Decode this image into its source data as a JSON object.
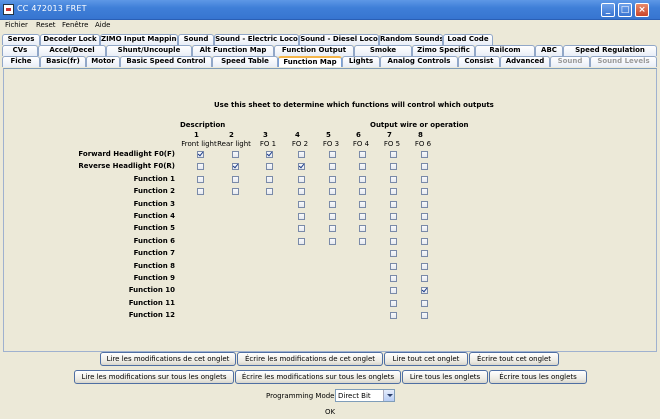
{
  "window": {
    "title": "CC 472013 FRET"
  },
  "menu": [
    "Fichier",
    "Reset",
    "Fenêtre",
    "Aide"
  ],
  "tabs": {
    "row1": [
      "Servos",
      "Decoder Lock",
      "ZIMO Input Mapping",
      "Sound",
      "Sound - Electric Loco",
      "Sound - Diesel Loco",
      "Random Sounds",
      "Load Code"
    ],
    "row2": [
      "CVs",
      "Accel/Decel",
      "Shunt/Uncouple",
      "Alt Function Map",
      "Function Output",
      "Smoke",
      "Zimo Specific",
      "Railcom",
      "ABC",
      "Speed Regulation"
    ],
    "row3": [
      "Fiche",
      "Basic(fr)",
      "Motor",
      "Basic Speed Control",
      "Speed Table",
      "Function Map",
      "Lights",
      "Analog Controls",
      "Consist",
      "Advanced",
      "Sound",
      "Sound Levels"
    ]
  },
  "sheet": {
    "intro": "Use this sheet to determine which functions will control which outputs",
    "description_header": "Description",
    "output_header": "Output wire or operation",
    "outputs": [
      {
        "num": "1",
        "name": "Front light"
      },
      {
        "num": "2",
        "name": "Rear light"
      },
      {
        "num": "3",
        "name": "FO 1"
      },
      {
        "num": "4",
        "name": "FO 2"
      },
      {
        "num": "5",
        "name": "FO 3"
      },
      {
        "num": "6",
        "name": "FO 4"
      },
      {
        "num": "7",
        "name": "FO 5"
      },
      {
        "num": "8",
        "name": "FO 6"
      }
    ],
    "rows": [
      {
        "label": "Forward Headlight F0(F)",
        "checked": [
          0,
          2
        ]
      },
      {
        "label": "Reverse Headlight F0(R)",
        "checked": [
          1,
          3
        ]
      },
      {
        "label": "Function 1",
        "checked": []
      },
      {
        "label": "Function 2",
        "checked": []
      },
      {
        "label": "Function 3",
        "checked": []
      },
      {
        "label": "Function 4",
        "checked": []
      },
      {
        "label": "Function 5",
        "checked": []
      },
      {
        "label": "Function 6",
        "checked": []
      },
      {
        "label": "Function 7",
        "checked": []
      },
      {
        "label": "Function 8",
        "checked": []
      },
      {
        "label": "Function 9",
        "checked": []
      },
      {
        "label": "Function 10",
        "checked": [
          7
        ]
      },
      {
        "label": "Function 11",
        "checked": []
      },
      {
        "label": "Function 12",
        "checked": []
      }
    ]
  },
  "buttons": {
    "read_sheet": "Lire les modifications de cet onglet",
    "write_sheet": "Écrire les modifications de cet onglet",
    "read_all_sheet": "Lire tout cet onglet",
    "write_all_sheet": "Écrire tout cet onglet",
    "read_all_tabs": "Lire les modifications sur tous les onglets",
    "write_all_tabs": "Écrire les modifications sur tous les onglets",
    "read_every": "Lire tous les onglets",
    "write_every": "Écrire tous les onglets"
  },
  "programming": {
    "label": "Programming Mode",
    "value": "Direct Bit"
  },
  "status": "OK"
}
